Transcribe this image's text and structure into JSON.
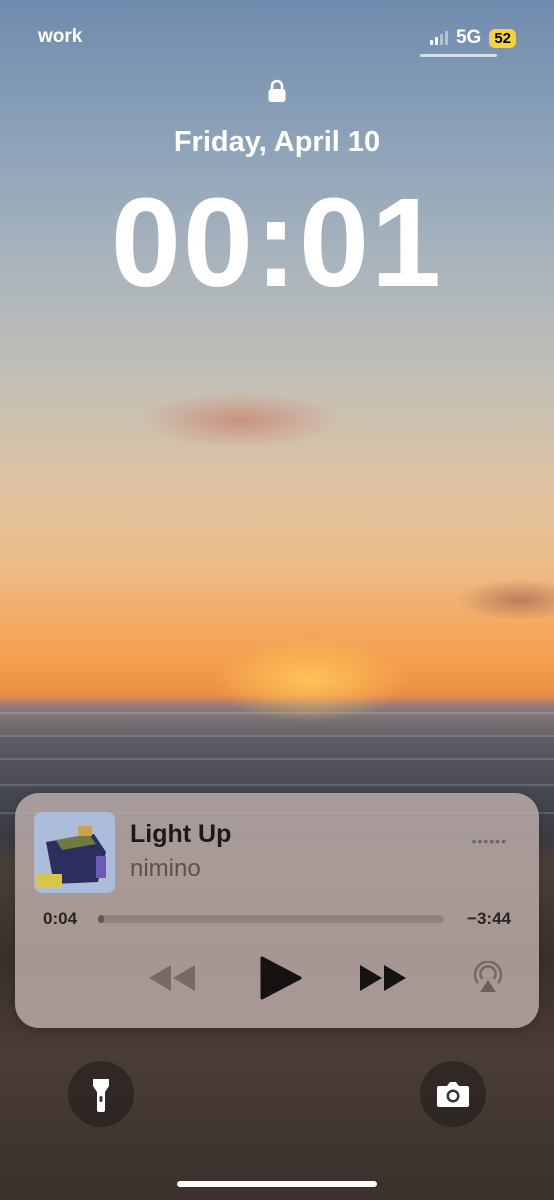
{
  "status_bar": {
    "carrier": "work",
    "network": "5G",
    "battery": "52"
  },
  "lock_screen": {
    "date": "Friday, April 10",
    "time": "00:01"
  },
  "now_playing": {
    "title": "Light Up",
    "artist": "nimino",
    "elapsed": "0:04",
    "remaining": "−3:44",
    "progress": 0.018,
    "controls": [
      "rewind-icon",
      "play-icon",
      "fast-forward-icon",
      "airplay-icon"
    ]
  },
  "quick_actions": [
    "flashlight-icon",
    "camera-icon"
  ],
  "colors": {
    "battery_badge": "#f5d33b",
    "text_white": "#ffffff"
  }
}
